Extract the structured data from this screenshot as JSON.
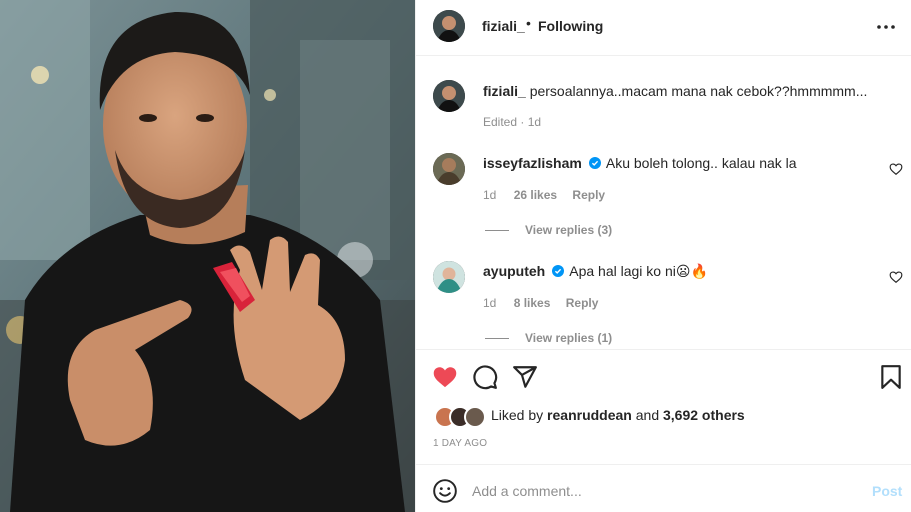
{
  "post": {
    "author": "fiziali_",
    "separator": "•",
    "follow_status": "Following",
    "caption": "persoalannya..macam mana nak cebok??hmmmmm...",
    "caption_meta": "Edited · 1d"
  },
  "comments": [
    {
      "user": "isseyfazlisham",
      "verified": true,
      "text": "Aku boleh tolong.. kalau nak la",
      "age": "1d",
      "likes": "26 likes",
      "reply_label": "Reply",
      "view_replies": "View replies (3)"
    },
    {
      "user": "ayuputeh",
      "verified": true,
      "text": "Apa hal lagi ko ni😦🔥",
      "age": "1d",
      "likes": "8 likes",
      "reply_label": "Reply",
      "view_replies": "View replies (1)"
    }
  ],
  "likes": {
    "prefix": "Liked by",
    "first_user": "reanruddean",
    "joiner": "and",
    "others": "3,692 others"
  },
  "time_ago": "1 DAY AGO",
  "composer": {
    "placeholder": "Add a comment...",
    "post_label": "Post"
  },
  "colors": {
    "like_active": "#ed4956",
    "verified": "#0095f6",
    "post_disabled": "#b2dffc"
  },
  "icons": {
    "like": "heart-icon",
    "comment": "comment-bubble-icon",
    "share": "paper-plane-icon",
    "save": "bookmark-icon",
    "more": "more-options-icon",
    "emoji": "emoji-smile-icon"
  }
}
